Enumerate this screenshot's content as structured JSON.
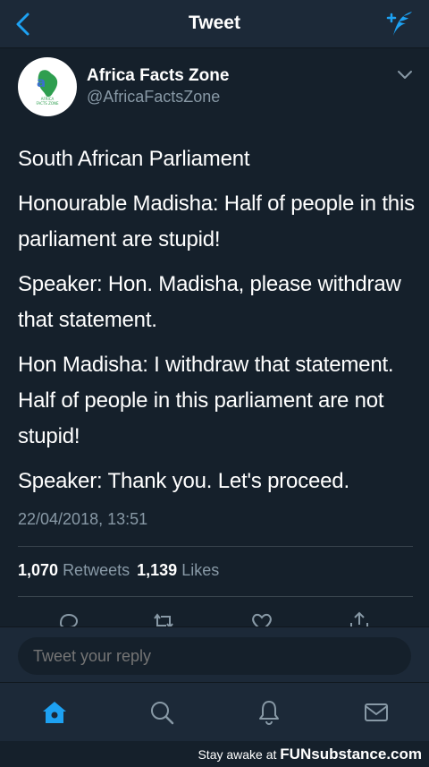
{
  "nav": {
    "title": "Tweet"
  },
  "author": {
    "name": "Africa Facts Zone",
    "handle": "@AfricaFactsZone",
    "avatar_text": "AFRICA FACTS ZONE"
  },
  "tweet": {
    "paragraphs": [
      "South African Parliament",
      "Honourable Madisha: Half of people in this parliament are stupid!",
      "Speaker: Hon. Madisha, please withdraw that statement.",
      "Hon Madisha: I withdraw that statement. Half of people in this parliament are not stupid!",
      "Speaker: Thank you. Let's proceed."
    ],
    "timestamp": "22/04/2018, 13:51"
  },
  "stats": {
    "retweets_count": "1,070",
    "retweets_label": "Retweets",
    "likes_count": "1,139",
    "likes_label": "Likes"
  },
  "reply": {
    "placeholder": "Tweet your reply"
  },
  "watermark": {
    "prefix": "Stay awake at",
    "brand": "FUNsubstance.com"
  },
  "colors": {
    "accent": "#1da1f2",
    "background": "#15202b",
    "bar": "#1c2938",
    "muted": "#8899a6"
  },
  "icons": {
    "back": "chevron-left-icon",
    "compose": "compose-feather-icon",
    "more": "chevron-down-icon",
    "reply": "reply-icon",
    "retweet": "retweet-icon",
    "like": "heart-icon",
    "share": "share-icon",
    "home": "home-icon",
    "search": "search-icon",
    "notifications": "bell-icon",
    "messages": "mail-icon"
  }
}
